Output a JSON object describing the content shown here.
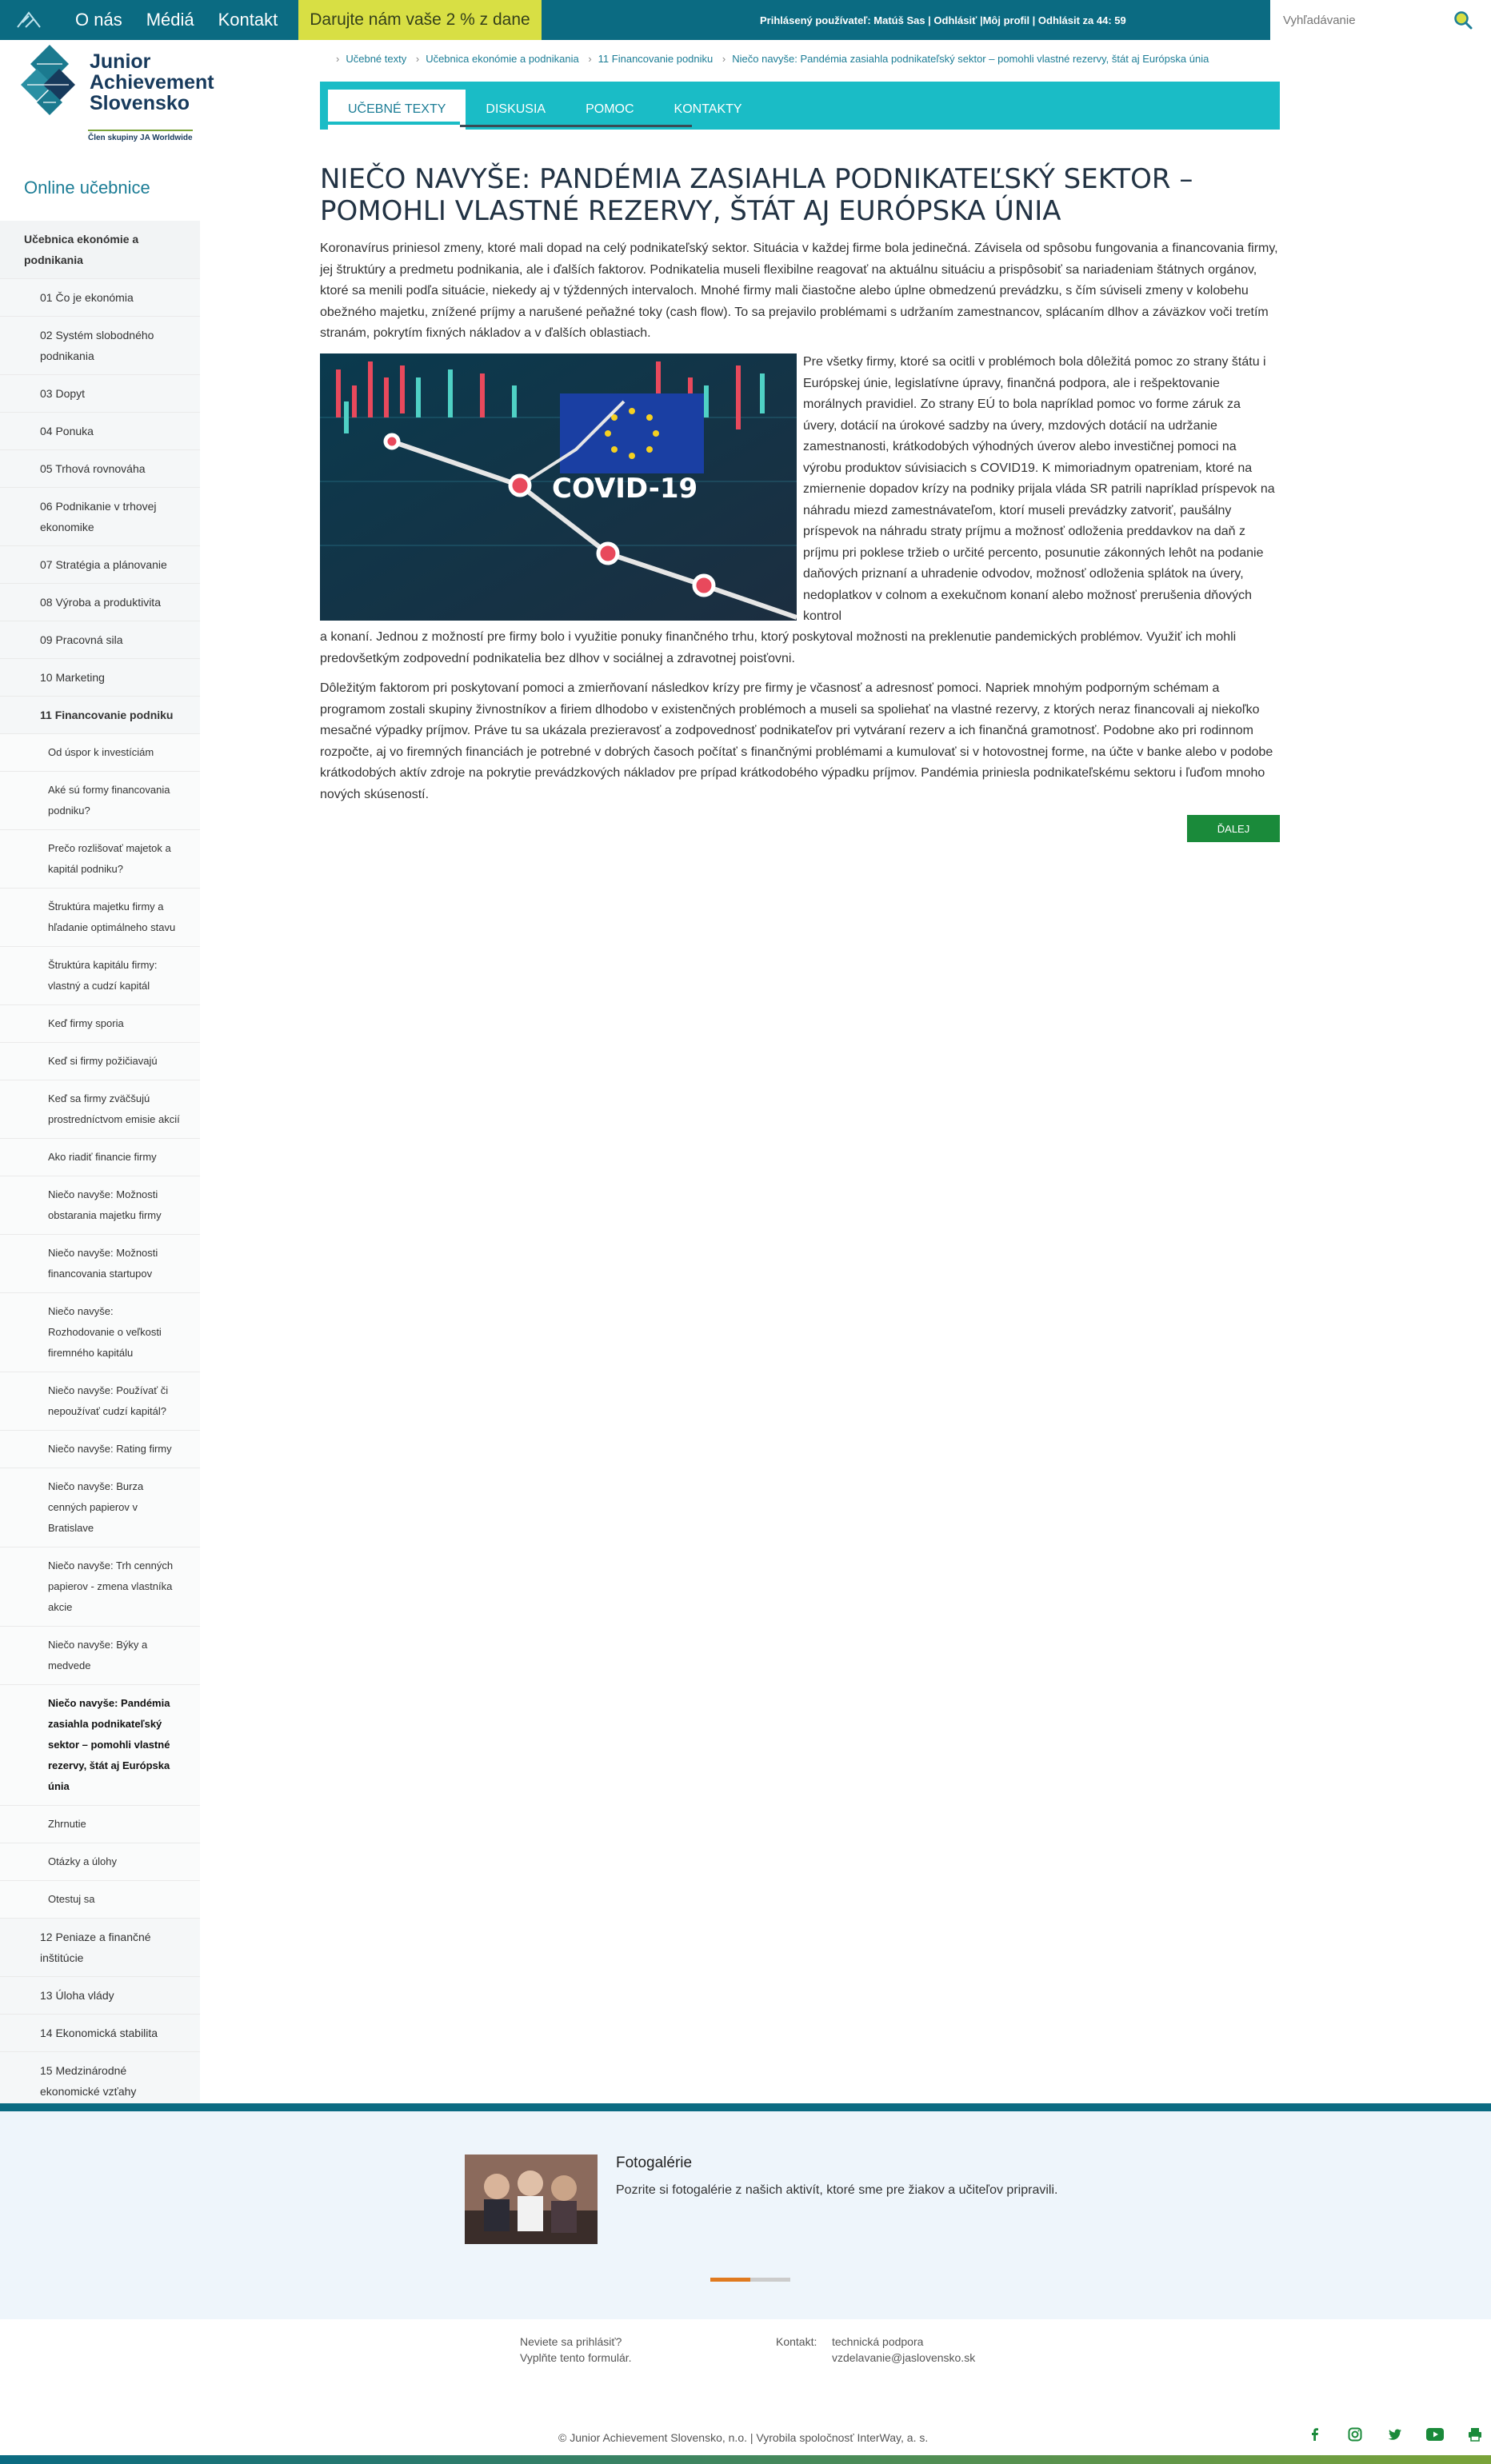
{
  "topbar": {
    "nav": [
      "O nás",
      "Médiá",
      "Kontakt"
    ],
    "donate": "Darujte nám vaše 2 % z dane",
    "user_info": "Prihlásený používateľ: Matúš Sas | Odhlásiť |Môj profil | Odhlásit za 44: 59",
    "search_placeholder": "Vyhľadávanie"
  },
  "brand": {
    "name_line1": "Junior",
    "name_line2": "Achievement",
    "name_line3": "Slovensko",
    "tagline": "Člen skupiny JA Worldwide"
  },
  "sidebar": {
    "title": "Online učebnice",
    "section": "Učebnica ekonómie a podnikania",
    "chapters_before": [
      "01 Čo je ekonómia",
      "02 Systém slobodného podnikania",
      "03 Dopyt",
      "04 Ponuka",
      "05 Trhová rovnováha",
      "06 Podnikanie v trhovej ekonomike",
      "07 Stratégia a plánovanie",
      "08 Výroba a produktivita",
      "09 Pracovná sila",
      "10 Marketing"
    ],
    "active_chapter": "11 Financovanie podniku",
    "subitems": [
      "Od úspor k investíciám",
      "Aké sú formy financovania podniku?",
      "Prečo rozlišovať majetok a kapitál podniku?",
      "Štruktúra majetku firmy a hľadanie optimálneho stavu",
      "Štruktúra kapitálu firmy: vlastný a cudzí kapitál",
      "Keď firmy sporia",
      "Keď si firmy požičiavajú",
      "Keď sa firmy zväčšujú prostredníctvom emisie akcií",
      "Ako riadiť financie firmy",
      "Niečo navyše: Možnosti obstarania majetku firmy",
      "Niečo navyše: Možnosti financovania startupov",
      "Niečo navyše: Rozhodovanie o veľkosti firemného kapitálu",
      "Niečo navyše: Používať či nepoužívať cudzí kapitál?",
      "Niečo navyše: Rating firmy",
      "Niečo navyše: Burza cenných papierov v Bratislave",
      "Niečo navyše: Trh cenných papierov - zmena vlastníka akcie",
      "Niečo navyše: Býky a medvede"
    ],
    "current_subitem": "Niečo navyše: Pandémia zasiahla podnikateľský sektor – pomohli vlastné rezervy, štát aj Európska únia",
    "subitems_after": [
      "Zhrnutie",
      "Otázky a úlohy",
      "Otestuj sa"
    ],
    "chapters_after": [
      "12 Peniaze a finančné inštitúcie",
      "13 Úloha vlády",
      "14 Ekonomická stabilita",
      "15 Medzinárodné ekonomické vzťahy",
      "Testy"
    ]
  },
  "breadcrumb": [
    "Učebné texty",
    "Učebnica ekonómie a podnikania",
    "11 Financovanie podniku",
    "Niečo navyše: Pandémia zasiahla podnikateľský sektor – pomohli vlastné rezervy, štát aj Európska únia"
  ],
  "tabs": [
    "Učebné texty",
    "Diskusia",
    "Pomoc",
    "Kontakty"
  ],
  "article": {
    "title": "NIEČO NAVYŠE: PANDÉMIA ZASIAHLA PODNIKATEĽSKÝ SEKTOR – POMOHLI VLASTNÉ REZERVY, ŠTÁT AJ EURÓPSKA ÚNIA",
    "p1": "Koronavírus priniesol zmeny, ktoré mali dopad na celý podnikateľský sektor. Situácia v každej firme bola jedinečná. Závisela od spôsobu fungovania a financovania firmy, jej štruktúry a predmetu podnikania,  ale i ďalších faktorov.  Podnikatelia museli flexibilne reagovať na aktuálnu situáciu a prispôsobiť sa nariadeniam štátnych orgánov, ktoré sa menili podľa situácie, niekedy aj v týždenných intervaloch. Mnohé firmy mali čiastočne alebo úplne obmedzenú prevádzku, s čím súviseli zmeny v kolobehu obežného majetku, znížené príjmy a  narušené peňažné toky (cash flow). To sa prejavilo problémami s udržaním zamestnancov, splácaním dlhov a záväzkov voči tretím stranám, pokrytím fixných nákladov a v ďalších oblastiach.",
    "p2_float": "Pre všetky firmy, ktoré sa ocitli v problémoch bola dôležitá pomoc zo strany štátu i Európskej únie,  legislatívne úpravy, finančná podpora, ale i rešpektovanie morálnych pravidiel.  Zo strany EÚ to bola napríklad pomoc vo forme záruk za úvery, dotácií na úrokové sadzby na úvery, mzdových dotácií na udržanie zamestnanosti,  krátkodobých výhodných úverov alebo investičnej pomoci na výrobu produktov súvisiacich s COVID19.  K mimoriadnym opatreniam, ktoré na zmiernenie dopadov krízy na podniky prijala vláda SR patrili  napríklad príspevok  na náhradu miezd zamestnávateľom, ktorí museli prevádzky zatvoriť, paušálny príspevok na náhradu straty príjmu  a možnosť odloženia preddavkov na daň z príjmu pri poklese tržieb o určité percento, posunutie zákonných lehôt na podanie daňových priznaní a uhradenie odvodov, možnosť odloženia splátok na úvery, nedoplatkov v colnom a exekučnom konaní alebo  možnosť prerušenia dňových kontrol",
    "p2_wrap": "a konaní. Jednou z možností pre firmy bolo i využitie ponuky finančného trhu, ktorý poskytoval možnosti na preklenutie pandemických problémov. Využiť ich mohli predovšetkým zodpovední podnikatelia bez dlhov v sociálnej a zdravotnej poisťovni.",
    "p3": "Dôležitým faktorom pri poskytovaní pomoci a zmierňovaní následkov krízy pre firmy je včasnosť a adresnosť pomoci. Napriek mnohým podporným schémam a programom zostali skupiny živnostníkov a firiem dlhodobo v existenčných problémoch a museli sa spoliehať na vlastné rezervy, z ktorých neraz financovali aj niekoľko mesačné výpadky príjmov. Práve tu sa ukázala prezieravosť a zodpovednosť podnikateľov pri vytváraní rezerv a ich finančná gramotnosť. Podobne ako pri rodinnom rozpočte, aj vo firemných financiách je potrebné v dobrých časoch počítať s finančnými problémami a kumulovať si v hotovostnej forme, na účte v banke alebo v podobe krátkodobých aktív zdroje na pokrytie prevádzkových nákladov pre prípad krátkodobého výpadku príjmov.  Pandémia priniesla podnikateľskému sektoru i ľuďom mnoho nových skúseností.",
    "image_label": "COVID-19",
    "next_button": "Ďalej"
  },
  "footer": {
    "gallery_title": "Fotogalérie",
    "gallery_desc": "Pozrite si fotogalérie z našich aktivít, ktoré sme pre žiakov a učiteľov pripravili.",
    "slider_progress": 0.5,
    "help_line1": "Neviete sa prihlásiť?",
    "help_line2": "Vyplňte tento formulár.",
    "contact_label": "Kontakt:",
    "contact_line1": "technická podpora",
    "contact_line2": "vzdelavanie@jaslovensko.sk",
    "copyright": "© Junior Achievement Slovensko, n.o. | Vyrobila spoločnosť InterWay, a. s.",
    "social_icons": [
      "facebook-icon",
      "instagram-icon",
      "twitter-icon",
      "youtube-icon",
      "print-icon"
    ]
  },
  "colors": {
    "topbar": "#0b6b82",
    "donate": "#d8df44",
    "tabs": "#1abcc6",
    "next_button": "#1a8a3a",
    "slider_fill": "#e07a1f",
    "brand_green": "#7aa339"
  }
}
